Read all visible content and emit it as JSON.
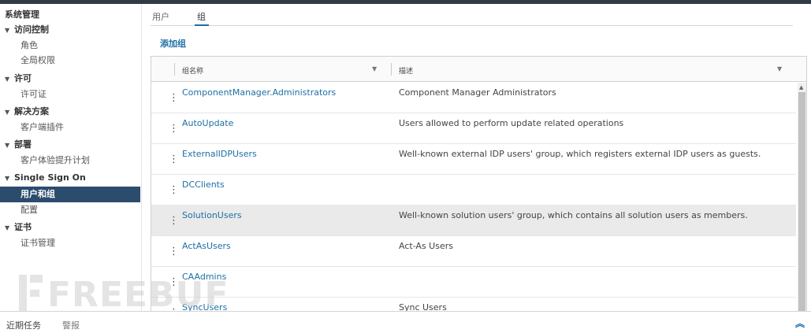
{
  "sidebar": {
    "title": "系统管理",
    "groups": [
      {
        "label": "访问控制",
        "items": [
          "角色",
          "全局权限"
        ]
      },
      {
        "label": "许可",
        "items": [
          "许可证"
        ]
      },
      {
        "label": "解决方案",
        "items": [
          "客户端插件"
        ]
      },
      {
        "label": "部署",
        "items": [
          "客户体验提升计划"
        ]
      },
      {
        "label": "Single Sign On",
        "items": [
          "用户和组",
          "配置"
        ]
      },
      {
        "label": "证书",
        "items": [
          "证书管理"
        ]
      }
    ],
    "active_item": "用户和组",
    "caret_glyph": "▼"
  },
  "tabs": [
    {
      "label": "用户",
      "active": false
    },
    {
      "label": "组",
      "active": true
    }
  ],
  "add_group_label": "添加组",
  "grid": {
    "columns": [
      {
        "label": "组名称",
        "filter_glyph": "▼"
      },
      {
        "label": "描述",
        "filter_glyph": "▼"
      }
    ],
    "rows": [
      {
        "name": "ComponentManager.Administrators",
        "description": "Component Manager Administrators",
        "highlighted": false
      },
      {
        "name": "AutoUpdate",
        "description": "Users allowed to perform update related operations",
        "highlighted": false
      },
      {
        "name": "ExternalIDPUsers",
        "description": "Well-known external IDP users' group, which registers external IDP users as guests.",
        "highlighted": false
      },
      {
        "name": "DCClients",
        "description": "",
        "highlighted": false
      },
      {
        "name": "SolutionUsers",
        "description": "Well-known solution users' group, which contains all solution users as members.",
        "highlighted": true
      },
      {
        "name": "ActAsUsers",
        "description": "Act-As Users",
        "highlighted": false
      },
      {
        "name": "CAAdmins",
        "description": "",
        "highlighted": false
      },
      {
        "name": "SyncUsers",
        "description": "Sync Users",
        "highlighted": false
      }
    ],
    "row_menu_glyph": "⋮"
  },
  "bottom_bar": {
    "tabs": [
      "近期任务",
      "警报"
    ],
    "expand_glyph": "⌃"
  },
  "watermark": "FREEBUF",
  "colors": {
    "accent": "#1d6fa5",
    "sidebar_active": "#2c4c6e",
    "topbar": "#313b47",
    "row_highlight": "#eaeaea"
  }
}
